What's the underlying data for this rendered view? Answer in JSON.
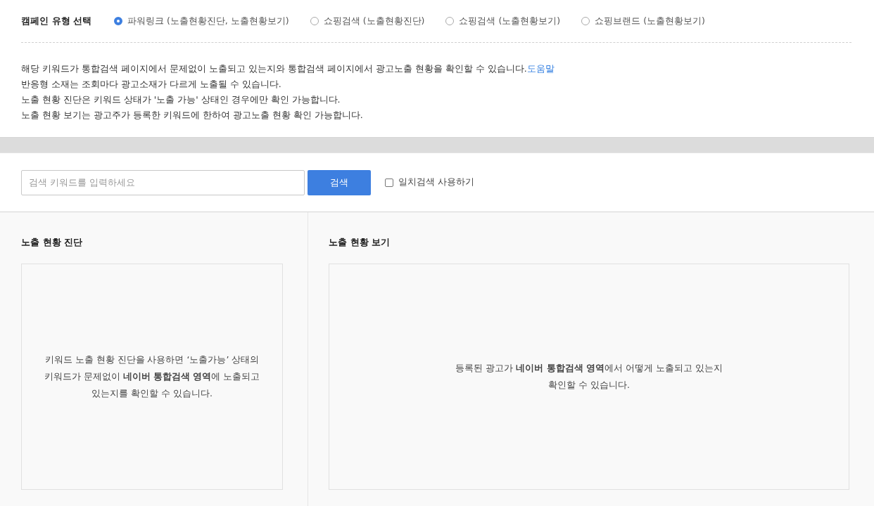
{
  "campaign_type": {
    "label": "캠페인 유형 선택",
    "options": [
      {
        "label": "파워링크 (노출현황진단, 노출현황보기)",
        "selected": true
      },
      {
        "label": "쇼핑검색 (노출현황진단)",
        "selected": false
      },
      {
        "label": "쇼핑검색 (노출현황보기)",
        "selected": false
      },
      {
        "label": "쇼핑브랜드 (노출현황보기)",
        "selected": false
      }
    ]
  },
  "notices": [
    {
      "text": "해당 키워드가 통합검색 페이지에서 문제없이 노출되고 있는지와 통합검색 페이지에서 광고노출 현황을 확인할 수 있습니다.",
      "link": "도움말"
    },
    {
      "text": "반응형 소재는 조회마다 광고소재가 다르게 노출될 수 있습니다."
    },
    {
      "text": "노출 현황 진단은 키워드 상태가 '노출 가능' 상태인 경우에만 확인 가능합니다."
    },
    {
      "text": "노출 현황 보기는 광고주가 등록한 키워드에 한하여 광고노출 현황 확인 가능합니다."
    }
  ],
  "search": {
    "placeholder": "검색 키워드를 입력하세요",
    "button": "검색",
    "exact_match": {
      "label": "일치검색 사용하기",
      "checked": false
    }
  },
  "panels": [
    {
      "title": "노출 현황 진단",
      "message": [
        "키워드 노출 현황 진단을 사용하면 ‘노출가능’ 상태의",
        "키워드가 문제없이 **네이버 통합검색 영역**에 노출되고",
        "있는지를 확인할 수 있습니다."
      ]
    },
    {
      "title": "노출 현황 보기",
      "message": [
        "등록된 광고가 **네이버 통합검색 영역**에서 어떻게 노출되고 있는지",
        "확인할 수 있습니다."
      ]
    }
  ]
}
